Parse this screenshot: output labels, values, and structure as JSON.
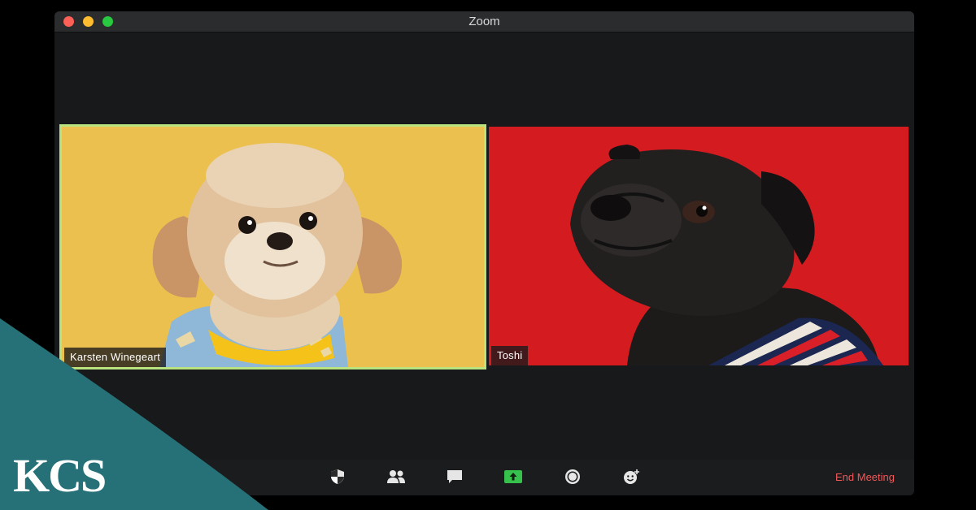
{
  "window": {
    "title": "Zoom"
  },
  "participants": [
    {
      "name": "Karsten Winegeart",
      "active_speaker": true,
      "background": "#ecc04f",
      "subject": "dog-shih-tzu"
    },
    {
      "name": "Toshi",
      "active_speaker": false,
      "background": "#d41c20",
      "subject": "dog-pug"
    }
  ],
  "toolbar": {
    "buttons": [
      {
        "id": "security",
        "icon": "shield-icon"
      },
      {
        "id": "participants",
        "icon": "participants-icon"
      },
      {
        "id": "chat",
        "icon": "chat-icon"
      },
      {
        "id": "share-screen",
        "icon": "share-screen-icon",
        "color": "#36c04c"
      },
      {
        "id": "record",
        "icon": "record-icon"
      },
      {
        "id": "reactions",
        "icon": "reactions-icon"
      }
    ],
    "end_meeting_label": "End Meeting",
    "end_meeting_color": "#f0585a"
  },
  "brand": {
    "logo_text": "KCS",
    "color": "#267077"
  }
}
